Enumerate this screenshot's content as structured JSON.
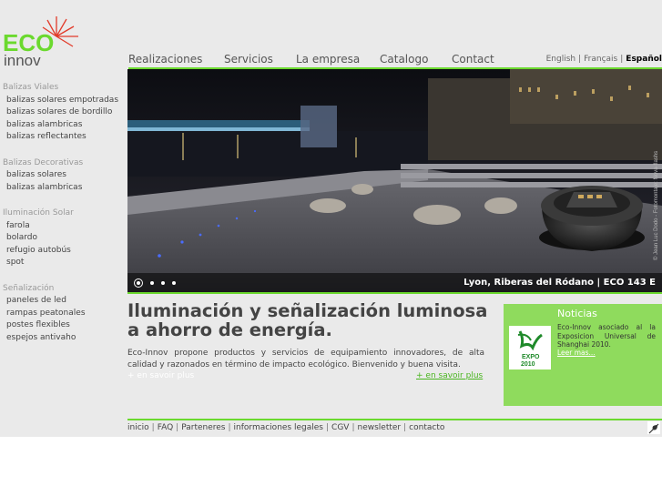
{
  "logo": {
    "line1": "ECO",
    "line2": "innov",
    "accent": "#e23b2a"
  },
  "nav": {
    "items": [
      {
        "label": "Realizaciones"
      },
      {
        "label": "Servicios"
      },
      {
        "label": "La empresa"
      },
      {
        "label": "Catalogo"
      },
      {
        "label": "Contact"
      }
    ],
    "languages": [
      "English",
      "Français",
      "Español"
    ],
    "active_language": "Español"
  },
  "sidebar": {
    "groups": [
      {
        "title": "Balizas Viales",
        "items": [
          "balizas solares empotradas",
          "balizas solares de bordillo",
          "balizas alambricas",
          "balizas reflectantes"
        ]
      },
      {
        "title": "Balizas Decorativas",
        "items": [
          "balizas solares",
          "balizas alambricas"
        ]
      },
      {
        "title": "Iluminación Solar",
        "items": [
          "farola",
          "bolardo",
          "refugio autobús",
          "spot"
        ]
      },
      {
        "title": "Señalización",
        "items": [
          "paneles de led",
          "rampas peatonales",
          "postes flexibles",
          "espejos antivaho"
        ]
      }
    ]
  },
  "hero": {
    "caption": "Lyon, Riberas del Ródano | ECO 143 E",
    "credit": "© Jean Luc Dodo - Fotomontaje: Nova-flashs",
    "slides": 4,
    "active_slide": 1
  },
  "main": {
    "headline": "Iluminación y señalización luminosa a ahorro de energía.",
    "intro": "Eco-Innov propone productos y servicios de equipamiento innovadores, de alta calidad y razonados en término de impacto ecológico. Bienvenido y buena visita.",
    "more_left": "+ en savoir plus",
    "more_right": "+ en savoir plus"
  },
  "news": {
    "title": "Noticias",
    "text": "Eco-Innov asociado al la Exposicion Universal de Shanghai 2010.",
    "more": "Leer mas...",
    "expo_logo_text": [
      "EXPO",
      "2010"
    ]
  },
  "footer": {
    "links": [
      "inicio",
      "FAQ",
      "Parteneres",
      "informaciones legales",
      "CGV",
      "newsletter",
      "contacto"
    ]
  },
  "colors": {
    "accent_green": "#6bd92e",
    "news_bg": "#8fdb5d",
    "page_bg": "#eaeaea"
  }
}
